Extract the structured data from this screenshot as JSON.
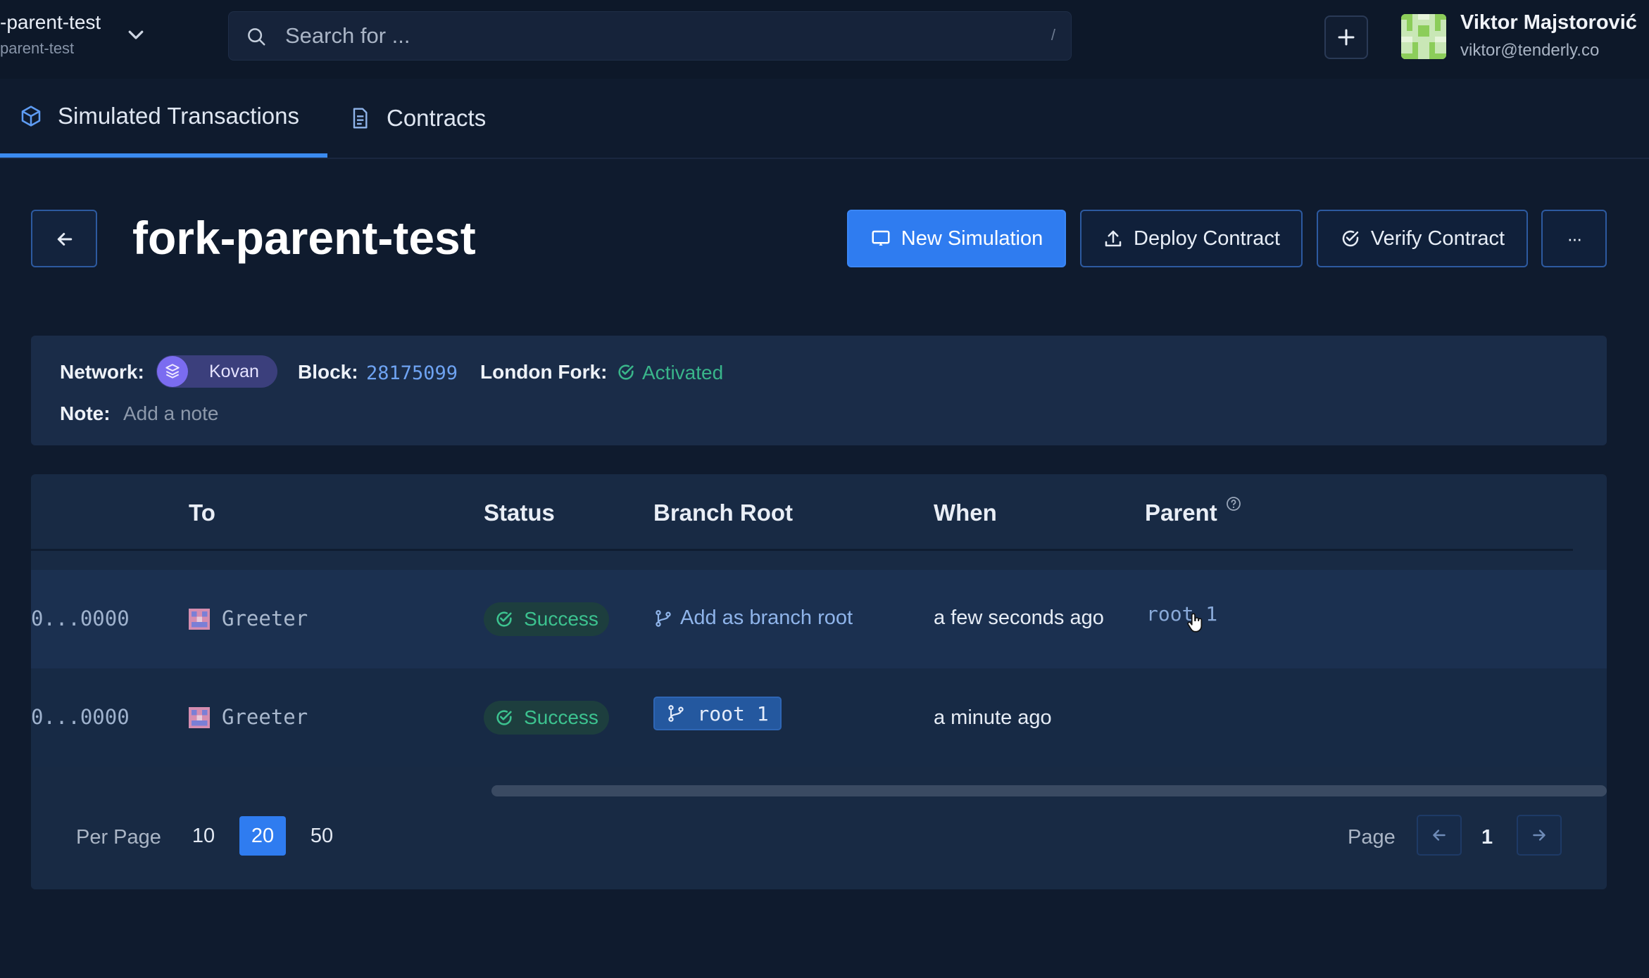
{
  "header": {
    "project_name": "-parent-test",
    "project_sub": "parent-test",
    "search_placeholder": "Search for ...",
    "search_shortcut": "/",
    "user_name": "Viktor Majstorović",
    "user_email": "viktor@tenderly.co"
  },
  "tabs": [
    {
      "label": "Simulated Transactions",
      "icon": "cube-icon",
      "active": true
    },
    {
      "label": "Contracts",
      "icon": "document-icon",
      "active": false
    }
  ],
  "page": {
    "title": "fork-parent-test",
    "buttons": {
      "new_simulation": "New Simulation",
      "deploy_contract": "Deploy Contract",
      "verify_contract": "Verify Contract",
      "more": "···"
    }
  },
  "info": {
    "network_label": "Network:",
    "network_value": "Kovan",
    "block_label": "Block:",
    "block_value": "28175099",
    "london_label": "London Fork:",
    "london_value": "Activated",
    "note_label": "Note:",
    "note_placeholder": "Add a note"
  },
  "table": {
    "columns": [
      "To",
      "Status",
      "Branch Root",
      "When",
      "Parent"
    ],
    "rows": [
      {
        "from": "0...0000",
        "to": "Greeter",
        "status": "Success",
        "branch_root": "Add as branch root",
        "when": "a few seconds ago",
        "parent": "root 1"
      },
      {
        "from": "0...0000",
        "to": "Greeter",
        "status": "Success",
        "branch_root": "root 1",
        "when": "a minute ago",
        "parent": ""
      }
    ]
  },
  "pagination": {
    "per_page_label": "Per Page",
    "per_page_options": [
      "10",
      "20",
      "50"
    ],
    "per_page_selected": "20",
    "page_label": "Page",
    "current_page": "1"
  },
  "colors": {
    "background": "#0f1b2e",
    "accent": "#2f7cf0",
    "success": "#3cc28f",
    "network": "#7b6cf0"
  }
}
